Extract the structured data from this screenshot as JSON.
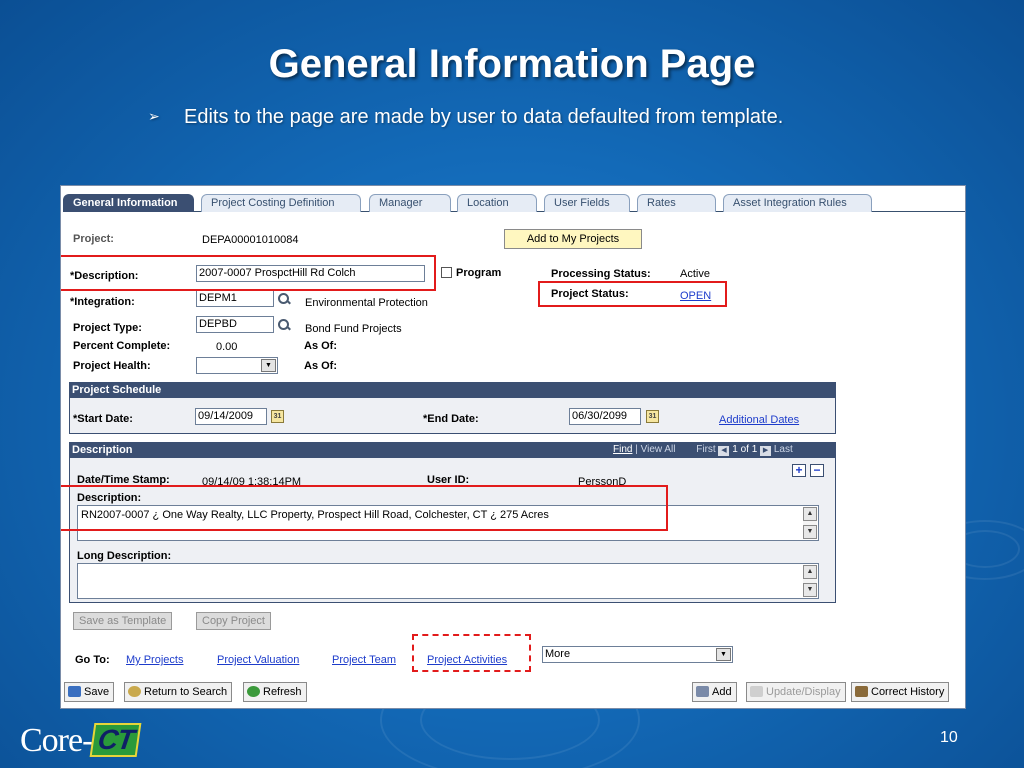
{
  "slide": {
    "title": "General Information Page",
    "bullet": "Edits to the page are made by user to data defaulted from template.",
    "page_number": "10",
    "logo_text": "Core-",
    "logo_badge": "CT"
  },
  "tabs": [
    {
      "label": "General Information",
      "active": true
    },
    {
      "label": "Project Costing Definition"
    },
    {
      "label": "Manager"
    },
    {
      "label": "Location"
    },
    {
      "label": "User Fields"
    },
    {
      "label": "Rates"
    },
    {
      "label": "Asset Integration Rules"
    }
  ],
  "header": {
    "project_label": "Project:",
    "project_value": "DEPA00001010084",
    "add_to_my_projects": "Add to My Projects"
  },
  "fields": {
    "description_label": "*Description:",
    "description_value": "2007-0007 ProspctHill Rd Colch",
    "program_label": "Program",
    "integration_label": "*Integration:",
    "integration_value": "DEPM1",
    "integration_desc": "Environmental Protection",
    "project_type_label": "Project Type:",
    "project_type_value": "DEPBD",
    "project_type_desc": "Bond Fund Projects",
    "percent_complete_label": "Percent Complete:",
    "percent_complete_value": "0.00",
    "as_of_label_1": "As Of:",
    "project_health_label": "Project Health:",
    "project_health_value": "",
    "as_of_label_2": "As Of:",
    "processing_status_label": "Processing Status:",
    "processing_status_value": "Active",
    "project_status_label": "Project Status:",
    "project_status_value": "OPEN"
  },
  "schedule": {
    "header": "Project Schedule",
    "start_label": "*Start Date:",
    "start_value": "09/14/2009",
    "end_label": "*End Date:",
    "end_value": "06/30/2099",
    "additional_dates": "Additional Dates"
  },
  "description_section": {
    "header": "Description",
    "find": "Find",
    "view_all": "| View All",
    "first": "First",
    "counter": "1 of 1",
    "last": "Last",
    "datetime_label": "Date/Time Stamp:",
    "datetime_value": "09/14/09  1:38:14PM",
    "userid_label": "User ID:",
    "userid_value": "PerssonD",
    "desc_label": "Description:",
    "desc_value": "RN2007-0007 ¿ One Way Realty, LLC Property, Prospect Hill Road, Colchester, CT ¿ 275 Acres",
    "long_desc_label": "Long Description:",
    "long_desc_value": ""
  },
  "actions": {
    "save_as_template": "Save as Template",
    "copy_project": "Copy Project"
  },
  "goto": {
    "label": "Go To:",
    "links": [
      "My Projects",
      "Project Valuation",
      "Project Team",
      "Project Activities"
    ],
    "more_select": "More"
  },
  "toolbar": {
    "save": "Save",
    "return_to_search": "Return to Search",
    "refresh": "Refresh",
    "add": "Add",
    "update_display": "Update/Display",
    "correct_history": "Correct History"
  }
}
